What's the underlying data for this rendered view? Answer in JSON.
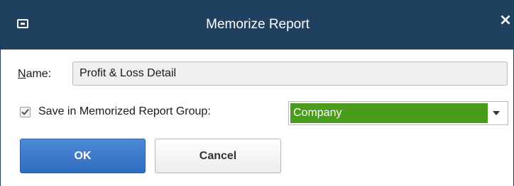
{
  "window": {
    "title": "Memorize Report",
    "close_glyph": "×"
  },
  "name_field": {
    "label_underlined": "N",
    "label_rest": "ame:",
    "value": "Profit & Loss Detail"
  },
  "save_group": {
    "checked": true,
    "label": "Save in Memorized Report Group:",
    "selected_value": "Company"
  },
  "buttons": {
    "ok_label": "OK",
    "cancel_label": "Cancel"
  },
  "colors": {
    "titlebar": "#20405f",
    "selected_highlight": "#4a9a1b",
    "primary_button": "#3a78c9"
  },
  "icons": {
    "system_menu": "window-menu-icon",
    "close": "close-icon",
    "dropdown": "chevron-down-icon",
    "checkmark": "checkmark-icon"
  }
}
